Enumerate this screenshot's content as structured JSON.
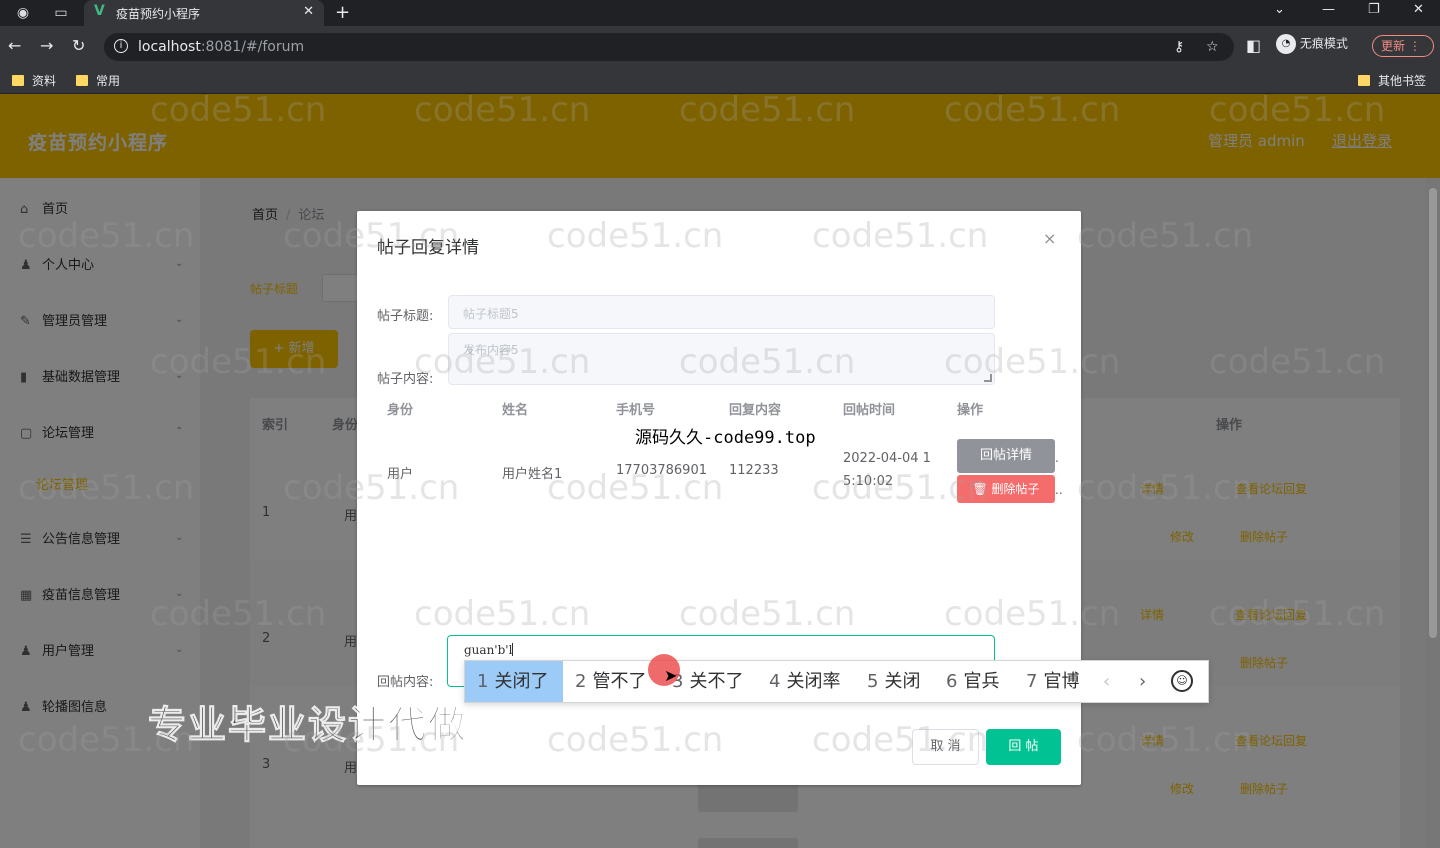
{
  "browser": {
    "tab_title": "疫苗预约小程序",
    "url_host": "localhost",
    "url_rest": ":8081/#/forum",
    "incognito_label": "无痕模式",
    "update_label": "更新",
    "bookmarks": [
      "资料",
      "常用"
    ],
    "other_bookmarks": "其他书签"
  },
  "app": {
    "title": "疫苗预约小程序",
    "admin_label": "管理员 admin",
    "logout": "退出登录"
  },
  "sidebar": {
    "items": [
      {
        "label": "首页",
        "icon": "home-icon"
      },
      {
        "label": "个人中心",
        "icon": "user-icon"
      },
      {
        "label": "管理员管理",
        "icon": "edit-icon"
      },
      {
        "label": "基础数据管理",
        "icon": "chart-icon"
      },
      {
        "label": "论坛管理",
        "icon": "forum-icon"
      },
      {
        "label": "公告信息管理",
        "icon": "list-icon"
      },
      {
        "label": "疫苗信息管理",
        "icon": "grid-icon"
      },
      {
        "label": "用户管理",
        "icon": "user-icon"
      },
      {
        "label": "轮播图信息",
        "icon": "user-icon"
      }
    ],
    "submenu_active": "论坛管理"
  },
  "main": {
    "breadcrumb_home": "首页",
    "breadcrumb_current": "论坛",
    "search_label": "帖子标题",
    "add_button": "+ 新增",
    "table_headers": {
      "index": "索引",
      "identity": "身份",
      "actions": "操作"
    },
    "rows": [
      {
        "index": "1",
        "role": "用"
      },
      {
        "index": "2",
        "role": "用"
      },
      {
        "index": "3",
        "role": "用"
      }
    ],
    "row_actions": {
      "detail": "详情",
      "view_reply": "查看论坛回复",
      "edit": "修改",
      "delete": "删除帖子"
    }
  },
  "dialog": {
    "title": "帖子回复详情",
    "close": "×",
    "post_title_label": "帖子标题:",
    "post_title_value": "帖子标题5",
    "post_content_label": "帖子内容:",
    "post_content_value": "发布内容5",
    "columns": [
      "身份",
      "姓名",
      "手机号",
      "回复内容",
      "回帖时间",
      "操作"
    ],
    "reply_row": {
      "identity": "用户",
      "name": "用户姓名1",
      "phone": "17703786901",
      "content": "112233",
      "time_line1": "2022-04-04 1",
      "time_line2": "5:10:02"
    },
    "detail_button": "回帖详情",
    "delete_button": "删除帖子",
    "reply_label": "回帖内容:",
    "reply_input": "guan'b'l",
    "cancel_button": "取 消",
    "submit_button": "回 帖"
  },
  "overlay_text": "源码久久-code99.top",
  "promo_text": "专业毕业设计代做",
  "watermark": "code51.cn",
  "ime": {
    "candidates": [
      {
        "num": "1",
        "text": "关闭了"
      },
      {
        "num": "2",
        "text": "管不了"
      },
      {
        "num": "3",
        "text": "关不了"
      },
      {
        "num": "4",
        "text": "关闭率"
      },
      {
        "num": "5",
        "text": "关闭"
      },
      {
        "num": "6",
        "text": "官兵"
      },
      {
        "num": "7",
        "text": "官博"
      }
    ],
    "prev": "‹",
    "next": "›"
  },
  "colors": {
    "brand": "#fcc400",
    "success": "#00c292",
    "danger": "#f56c6c",
    "info": "#909399"
  }
}
